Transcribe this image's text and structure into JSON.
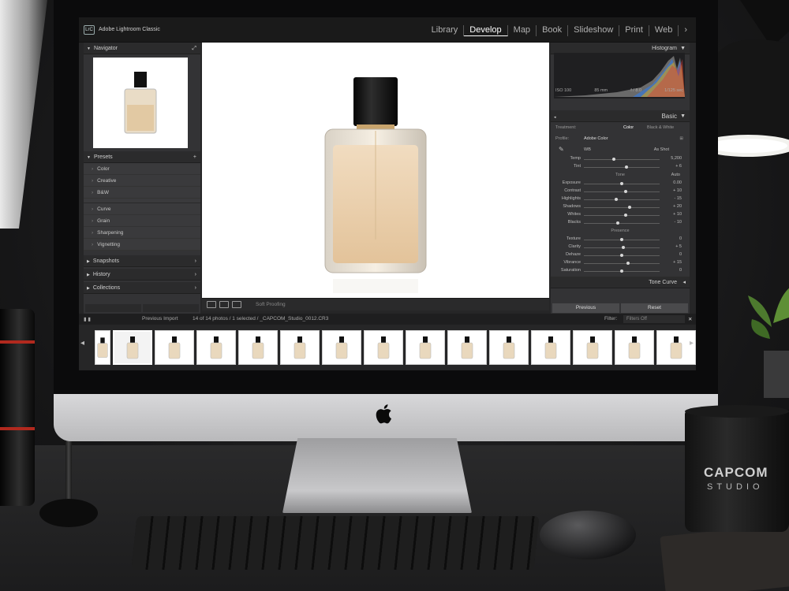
{
  "app": {
    "logo": "LrC",
    "name": "Adobe Lightroom Classic"
  },
  "modules": [
    "Library",
    "Develop",
    "Map",
    "Book",
    "Slideshow",
    "Print",
    "Web"
  ],
  "active_module": "Develop",
  "modules_more": "›",
  "left_panel": {
    "navigator": "Navigator",
    "presets": "Presets",
    "preset_items": [
      "Color",
      "Creative",
      "B&W",
      "Curve",
      "Grain",
      "Sharpening",
      "Vignetting"
    ],
    "snapshots": "Snapshots",
    "history": "History",
    "collections": "Collections"
  },
  "toolbar": {
    "soft_proofing": "Soft Proofing"
  },
  "right_panel": {
    "histogram": "Histogram",
    "iso": "ISO 100",
    "focal": "85 mm",
    "aperture": "f / 8.0",
    "shutter": "1/125 sec",
    "basic": "Basic",
    "treatment_label": "Treatment:",
    "treatment_color": "Color",
    "treatment_bw": "Black & White",
    "profile_label": "Profile:",
    "profile_value": "Adobe Color",
    "wb_label": "WB",
    "wb_value": "As Shot",
    "temp": {
      "label": "Temp",
      "value": "5,200",
      "level": 0.4
    },
    "tint": {
      "label": "Tint",
      "value": "+ 6",
      "level": 0.56
    },
    "tone_label": "Tone",
    "auto_label": "Auto",
    "tone": [
      {
        "label": "Exposure",
        "value": "0.00",
        "level": 0.5
      },
      {
        "label": "Contrast",
        "value": "+ 10",
        "level": 0.55
      },
      {
        "label": "Highlights",
        "value": "- 15",
        "level": 0.43
      },
      {
        "label": "Shadows",
        "value": "+ 20",
        "level": 0.6
      },
      {
        "label": "Whites",
        "value": "+ 10",
        "level": 0.55
      },
      {
        "label": "Blacks",
        "value": "- 10",
        "level": 0.45
      }
    ],
    "presence_label": "Presence",
    "presence": [
      {
        "label": "Texture",
        "value": "0",
        "level": 0.5
      },
      {
        "label": "Clarity",
        "value": "+ 5",
        "level": 0.52
      },
      {
        "label": "Dehaze",
        "value": "0",
        "level": 0.5
      },
      {
        "label": "Vibrance",
        "value": "+ 15",
        "level": 0.58
      },
      {
        "label": "Saturation",
        "value": "0",
        "level": 0.5
      }
    ],
    "tone_curve": "Tone Curve",
    "previous": "Previous",
    "reset": "Reset"
  },
  "filmstrip": {
    "source": "Previous Import",
    "info": "14 of 14 photos / 1 selected / _CAPCOM_Studio_0012.CR3",
    "filter_label": "Filter:",
    "filter_value": "Filters Off",
    "thumb_count": 14
  },
  "mug": {
    "line1": "CAPCOM",
    "line2": "STUDIO"
  }
}
